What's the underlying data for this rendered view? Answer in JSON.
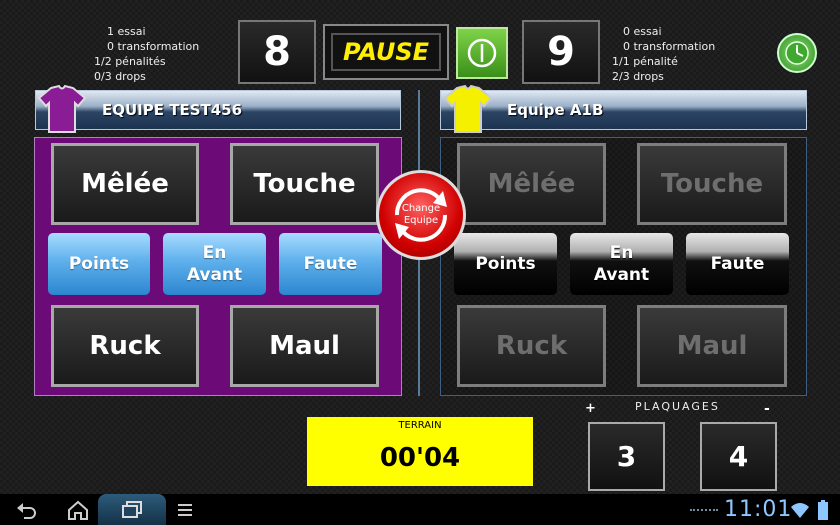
{
  "left_stats": [
    "1 essai",
    "0 transformation",
    "1/2 pénalités",
    "0/3 drops"
  ],
  "right_stats": [
    "0 essai",
    "0 transformation",
    "1/1 pénalité",
    "2/3 drops"
  ],
  "score_left": "8",
  "score_right": "9",
  "pause_label": "PAUSE",
  "team_left": {
    "name": "EQUIPE TEST456",
    "jersey_color": "#8a1c96"
  },
  "team_right": {
    "name": "Equipe A1B",
    "jersey_color": "#f4f000"
  },
  "buttons": {
    "melee": "Mêlée",
    "touche": "Touche",
    "points": "Points",
    "en_avant_1": "En",
    "en_avant_2": "Avant",
    "faute": "Faute",
    "ruck": "Ruck",
    "maul": "Maul"
  },
  "change_equipe": {
    "line1": "Change",
    "line2": "Equipe"
  },
  "terrain": {
    "label": "TERRAIN",
    "time": "00'04"
  },
  "plaquages": {
    "title": "PLAQUAGES",
    "plus": "+",
    "minus": "-",
    "left": "3",
    "right": "4"
  },
  "statusbar": {
    "time": "11:01"
  },
  "colors": {
    "accent_yellow": "#ffff00",
    "panel_purple": "#6c0a78",
    "blue_button": "#5fb0ec"
  }
}
